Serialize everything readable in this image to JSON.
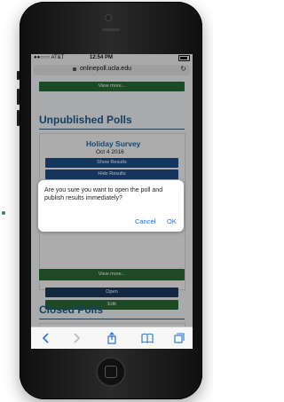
{
  "status_bar": {
    "carrier": "●●○○○ AT&T",
    "time": "12:54 PM",
    "battery": "battery-icon"
  },
  "browser": {
    "url": "onlinepoll.ucla.edu"
  },
  "page": {
    "top_view_more": "View more...",
    "unpublished": {
      "title": "Unpublished Polls",
      "poll_title": "Holiday Survey",
      "poll_date": "Oct 4 2016",
      "show_results": "Show Results",
      "hide_results": "Hide Results",
      "open": "Open",
      "edit": "Edit",
      "view_more": "View more..."
    },
    "closed": {
      "title": "Closed Polls"
    }
  },
  "dialog": {
    "message": "Are you sure you want to open the poll and publish results immediately?",
    "cancel": "Cancel",
    "ok": "OK"
  },
  "colors": {
    "accent": "#1d5c8f",
    "green_button": "#2a6b34",
    "blue_button": "#1d4e86",
    "dialog_action": "#2b6fd6"
  }
}
